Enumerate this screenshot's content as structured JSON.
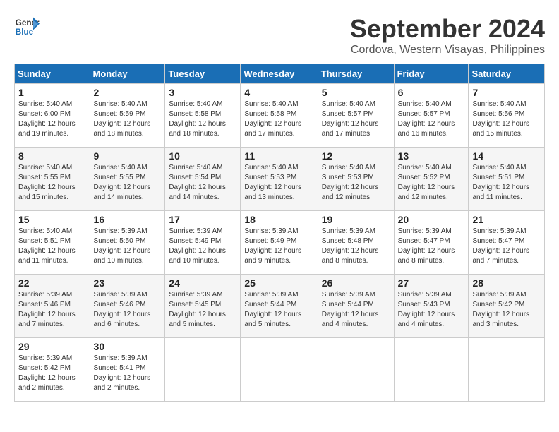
{
  "logo": {
    "line1": "General",
    "line2": "Blue"
  },
  "title": "September 2024",
  "subtitle": "Cordova, Western Visayas, Philippines",
  "days_of_week": [
    "Sunday",
    "Monday",
    "Tuesday",
    "Wednesday",
    "Thursday",
    "Friday",
    "Saturday"
  ],
  "weeks": [
    [
      {
        "num": "1",
        "sunrise": "5:40 AM",
        "sunset": "6:00 PM",
        "daylight": "12 hours and 19 minutes."
      },
      {
        "num": "2",
        "sunrise": "5:40 AM",
        "sunset": "5:59 PM",
        "daylight": "12 hours and 18 minutes."
      },
      {
        "num": "3",
        "sunrise": "5:40 AM",
        "sunset": "5:58 PM",
        "daylight": "12 hours and 18 minutes."
      },
      {
        "num": "4",
        "sunrise": "5:40 AM",
        "sunset": "5:58 PM",
        "daylight": "12 hours and 17 minutes."
      },
      {
        "num": "5",
        "sunrise": "5:40 AM",
        "sunset": "5:57 PM",
        "daylight": "12 hours and 17 minutes."
      },
      {
        "num": "6",
        "sunrise": "5:40 AM",
        "sunset": "5:57 PM",
        "daylight": "12 hours and 16 minutes."
      },
      {
        "num": "7",
        "sunrise": "5:40 AM",
        "sunset": "5:56 PM",
        "daylight": "12 hours and 15 minutes."
      }
    ],
    [
      {
        "num": "8",
        "sunrise": "5:40 AM",
        "sunset": "5:55 PM",
        "daylight": "12 hours and 15 minutes."
      },
      {
        "num": "9",
        "sunrise": "5:40 AM",
        "sunset": "5:55 PM",
        "daylight": "12 hours and 14 minutes."
      },
      {
        "num": "10",
        "sunrise": "5:40 AM",
        "sunset": "5:54 PM",
        "daylight": "12 hours and 14 minutes."
      },
      {
        "num": "11",
        "sunrise": "5:40 AM",
        "sunset": "5:53 PM",
        "daylight": "12 hours and 13 minutes."
      },
      {
        "num": "12",
        "sunrise": "5:40 AM",
        "sunset": "5:53 PM",
        "daylight": "12 hours and 12 minutes."
      },
      {
        "num": "13",
        "sunrise": "5:40 AM",
        "sunset": "5:52 PM",
        "daylight": "12 hours and 12 minutes."
      },
      {
        "num": "14",
        "sunrise": "5:40 AM",
        "sunset": "5:51 PM",
        "daylight": "12 hours and 11 minutes."
      }
    ],
    [
      {
        "num": "15",
        "sunrise": "5:40 AM",
        "sunset": "5:51 PM",
        "daylight": "12 hours and 11 minutes."
      },
      {
        "num": "16",
        "sunrise": "5:39 AM",
        "sunset": "5:50 PM",
        "daylight": "12 hours and 10 minutes."
      },
      {
        "num": "17",
        "sunrise": "5:39 AM",
        "sunset": "5:49 PM",
        "daylight": "12 hours and 10 minutes."
      },
      {
        "num": "18",
        "sunrise": "5:39 AM",
        "sunset": "5:49 PM",
        "daylight": "12 hours and 9 minutes."
      },
      {
        "num": "19",
        "sunrise": "5:39 AM",
        "sunset": "5:48 PM",
        "daylight": "12 hours and 8 minutes."
      },
      {
        "num": "20",
        "sunrise": "5:39 AM",
        "sunset": "5:47 PM",
        "daylight": "12 hours and 8 minutes."
      },
      {
        "num": "21",
        "sunrise": "5:39 AM",
        "sunset": "5:47 PM",
        "daylight": "12 hours and 7 minutes."
      }
    ],
    [
      {
        "num": "22",
        "sunrise": "5:39 AM",
        "sunset": "5:46 PM",
        "daylight": "12 hours and 7 minutes."
      },
      {
        "num": "23",
        "sunrise": "5:39 AM",
        "sunset": "5:46 PM",
        "daylight": "12 hours and 6 minutes."
      },
      {
        "num": "24",
        "sunrise": "5:39 AM",
        "sunset": "5:45 PM",
        "daylight": "12 hours and 5 minutes."
      },
      {
        "num": "25",
        "sunrise": "5:39 AM",
        "sunset": "5:44 PM",
        "daylight": "12 hours and 5 minutes."
      },
      {
        "num": "26",
        "sunrise": "5:39 AM",
        "sunset": "5:44 PM",
        "daylight": "12 hours and 4 minutes."
      },
      {
        "num": "27",
        "sunrise": "5:39 AM",
        "sunset": "5:43 PM",
        "daylight": "12 hours and 4 minutes."
      },
      {
        "num": "28",
        "sunrise": "5:39 AM",
        "sunset": "5:42 PM",
        "daylight": "12 hours and 3 minutes."
      }
    ],
    [
      {
        "num": "29",
        "sunrise": "5:39 AM",
        "sunset": "5:42 PM",
        "daylight": "12 hours and 2 minutes."
      },
      {
        "num": "30",
        "sunrise": "5:39 AM",
        "sunset": "5:41 PM",
        "daylight": "12 hours and 2 minutes."
      },
      null,
      null,
      null,
      null,
      null
    ]
  ]
}
